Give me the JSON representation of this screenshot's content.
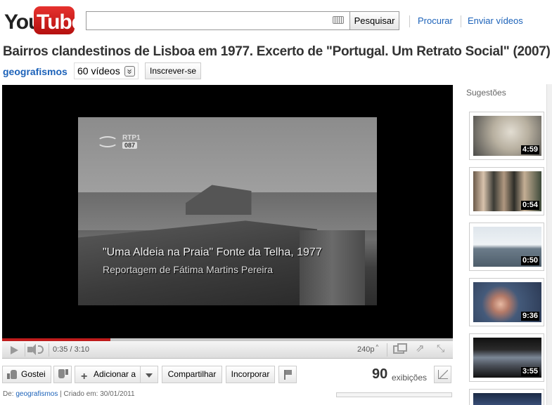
{
  "header": {
    "logo_you": "You",
    "logo_tube": "Tube",
    "search_placeholder": "",
    "search_button": "Pesquisar",
    "nav_browse": "Procurar",
    "nav_upload": "Enviar vídeos"
  },
  "video": {
    "title": "Bairros clandestinos de Lisboa em 1977. Excerto de \"Portugal. Um Retrato Social\" (2007)",
    "channel": "geografismos",
    "channel_videos": "60 vídeos",
    "subscribe": "Inscrever-se",
    "frame_logo": "RTP1",
    "frame_logo_sub": "087",
    "caption_line1": "\"Uma Aldeia na Praia\" Fonte da Telha, 1977",
    "caption_line2": "Reportagem de Fátima Martins Pereira",
    "progress_loaded": 0.24
  },
  "controls": {
    "time": "0:35 / 3:10",
    "quality": "240p"
  },
  "actions": {
    "like": "Gostei",
    "add_to": "Adicionar a",
    "share": "Compartilhar",
    "embed": "Incorporar",
    "views_count": "90",
    "views_label": "exibições"
  },
  "meta": {
    "prefix": "De:",
    "author": "geografismos",
    "created": "| Criado em: 30/01/2011"
  },
  "sidebar": {
    "title": "Sugestões",
    "items": [
      {
        "duration": "4:59"
      },
      {
        "duration": "0:54"
      },
      {
        "duration": "0:50"
      },
      {
        "duration": "9:36"
      },
      {
        "duration": "3:55"
      },
      {
        "duration": ""
      }
    ]
  }
}
